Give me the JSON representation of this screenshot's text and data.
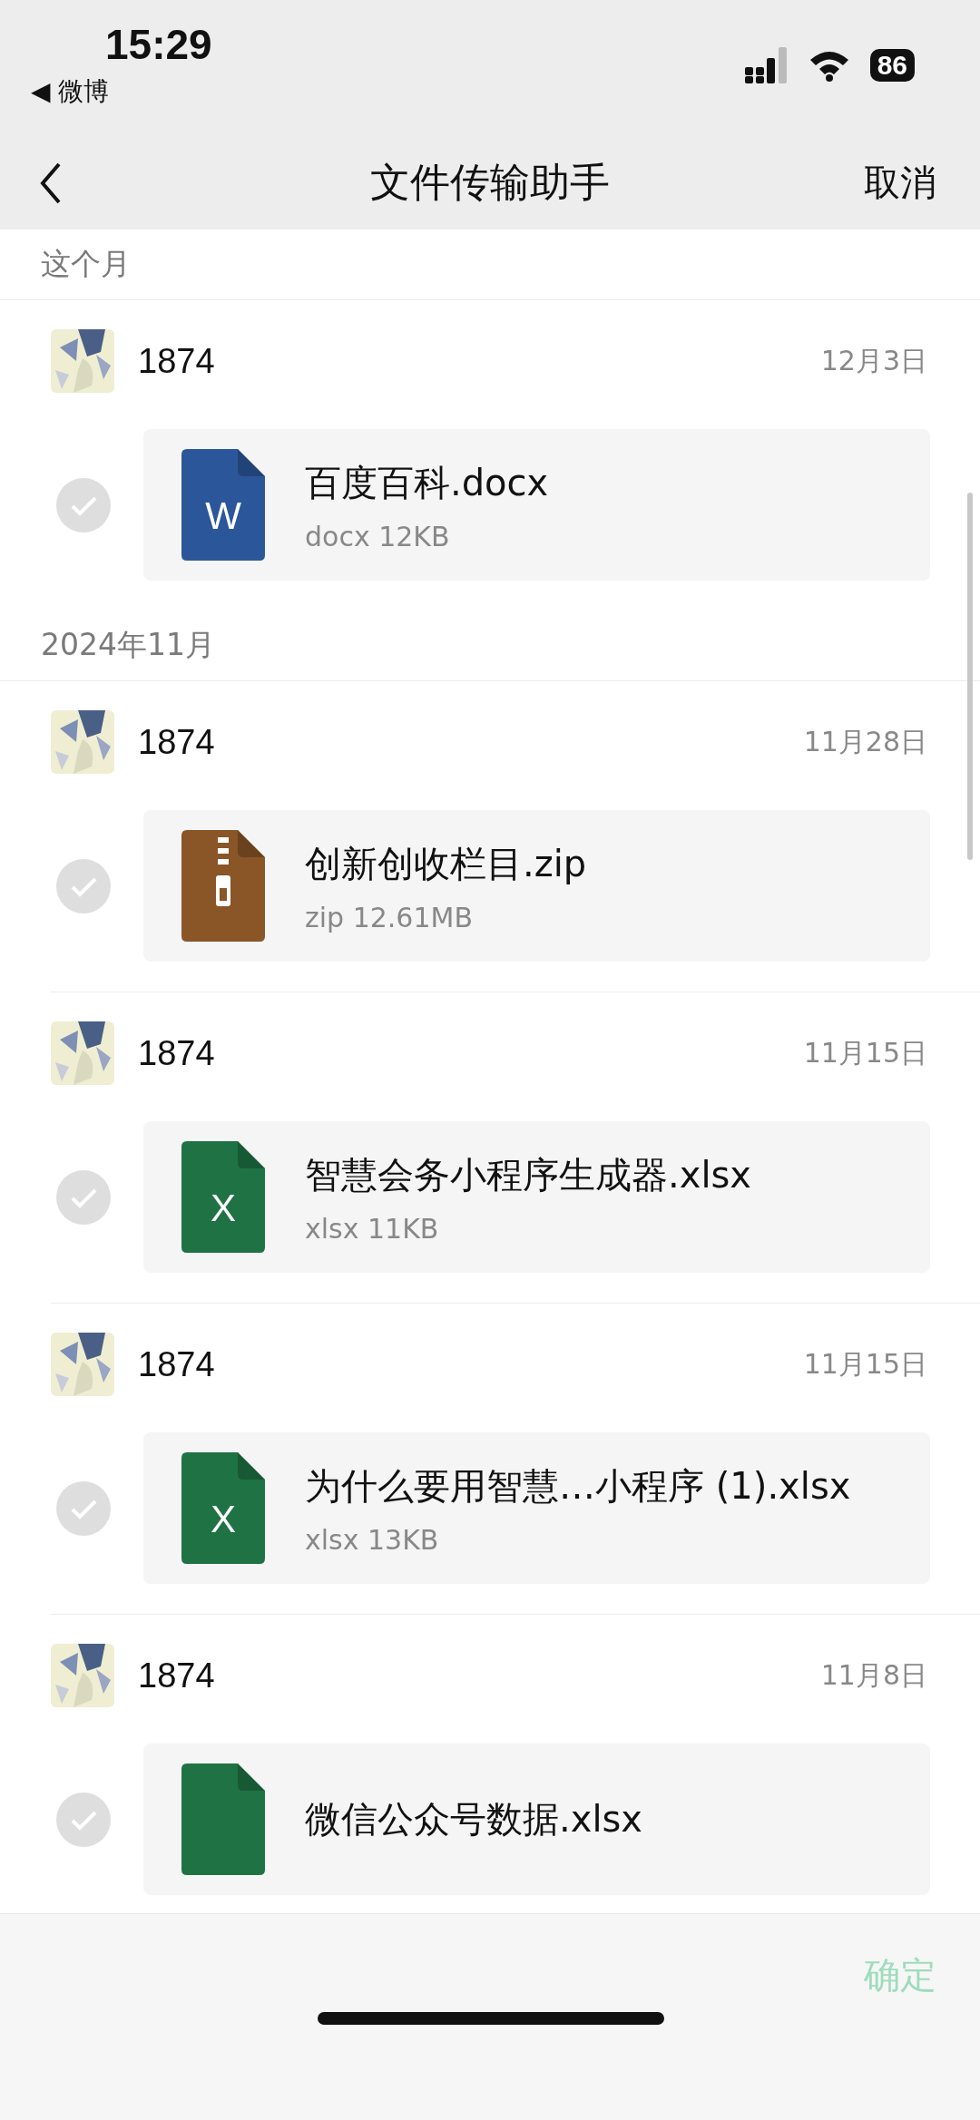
{
  "status_bar": {
    "time": "15:29",
    "back_app": "◀ 微博",
    "battery": "86"
  },
  "nav": {
    "title": "文件传输助手",
    "cancel": "取消"
  },
  "sections": [
    {
      "title": "这个月",
      "items": [
        {
          "sender": "1874",
          "date": "12月3日",
          "selected": false,
          "file": {
            "kind": "docx",
            "badge": "W",
            "name": "百度百科.docx",
            "size": "docx 12KB"
          }
        }
      ]
    },
    {
      "title": "2024年11月",
      "items": [
        {
          "sender": "1874",
          "date": "11月28日",
          "selected": false,
          "file": {
            "kind": "zip",
            "name": "创新创收栏目.zip",
            "size": "zip 12.61MB"
          }
        },
        {
          "sender": "1874",
          "date": "11月15日",
          "selected": false,
          "file": {
            "kind": "xlsx",
            "badge": "X",
            "name": "智慧会务小程序生成器.xlsx",
            "size": "xlsx 11KB"
          }
        },
        {
          "sender": "1874",
          "date": "11月15日",
          "selected": false,
          "file": {
            "kind": "xlsx",
            "badge": "X",
            "name": "为什么要用智慧…小程序 (1).xlsx",
            "size": "xlsx 13KB"
          }
        },
        {
          "sender": "1874",
          "date": "11月8日",
          "selected": false,
          "file": {
            "kind": "xlsx",
            "name": "微信公众号数据.xlsx"
          }
        }
      ]
    }
  ],
  "confirm": {
    "label": "确定",
    "disabled": true
  }
}
